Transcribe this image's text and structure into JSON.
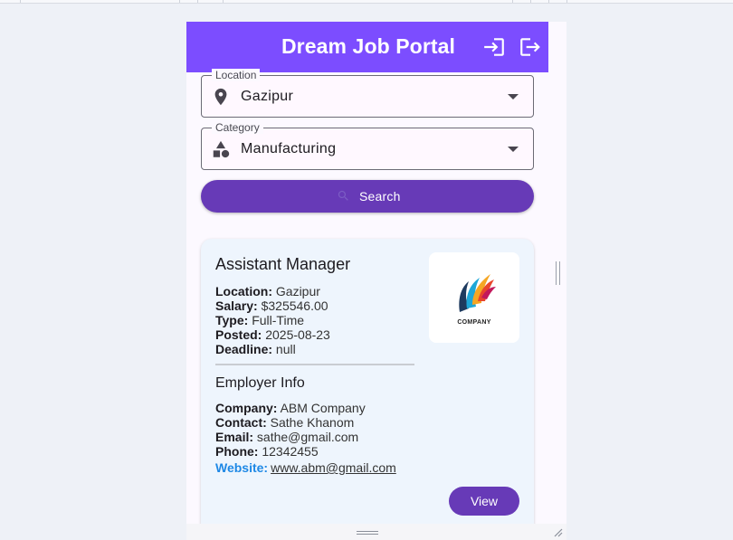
{
  "app": {
    "title": "Dream Job Portal",
    "login_icon": "login-icon",
    "logout_icon": "logout-icon",
    "accent_color": "#7c4dff",
    "button_color": "#673ab7"
  },
  "filters": {
    "location": {
      "label": "Location",
      "value": "Gazipur",
      "icon": "location-pin-icon"
    },
    "category": {
      "label": "Category",
      "value": "Manufacturing",
      "icon": "shapes-icon"
    },
    "search_label": "Search"
  },
  "job": {
    "title": "Assistant Manager",
    "fields": [
      {
        "label": "Location:",
        "value": "Gazipur"
      },
      {
        "label": "Salary:",
        "value": "$325546.00"
      },
      {
        "label": "Type:",
        "value": "Full-Time"
      },
      {
        "label": "Posted:",
        "value": "2025-08-23"
      },
      {
        "label": "Deadline:",
        "value": "null"
      }
    ],
    "employer_heading": "Employer Info",
    "employer": [
      {
        "label": "Company:",
        "value": "ABM Company"
      },
      {
        "label": "Contact:",
        "value": "Sathe Khanom"
      },
      {
        "label": "Email:",
        "value": "sathe@gmail.com"
      },
      {
        "label": "Phone:",
        "value": "12342455"
      }
    ],
    "website_label": "Website:",
    "website_value": "www.abm@gmail.com",
    "logo_text": "COMPANY",
    "view_label": "View"
  }
}
